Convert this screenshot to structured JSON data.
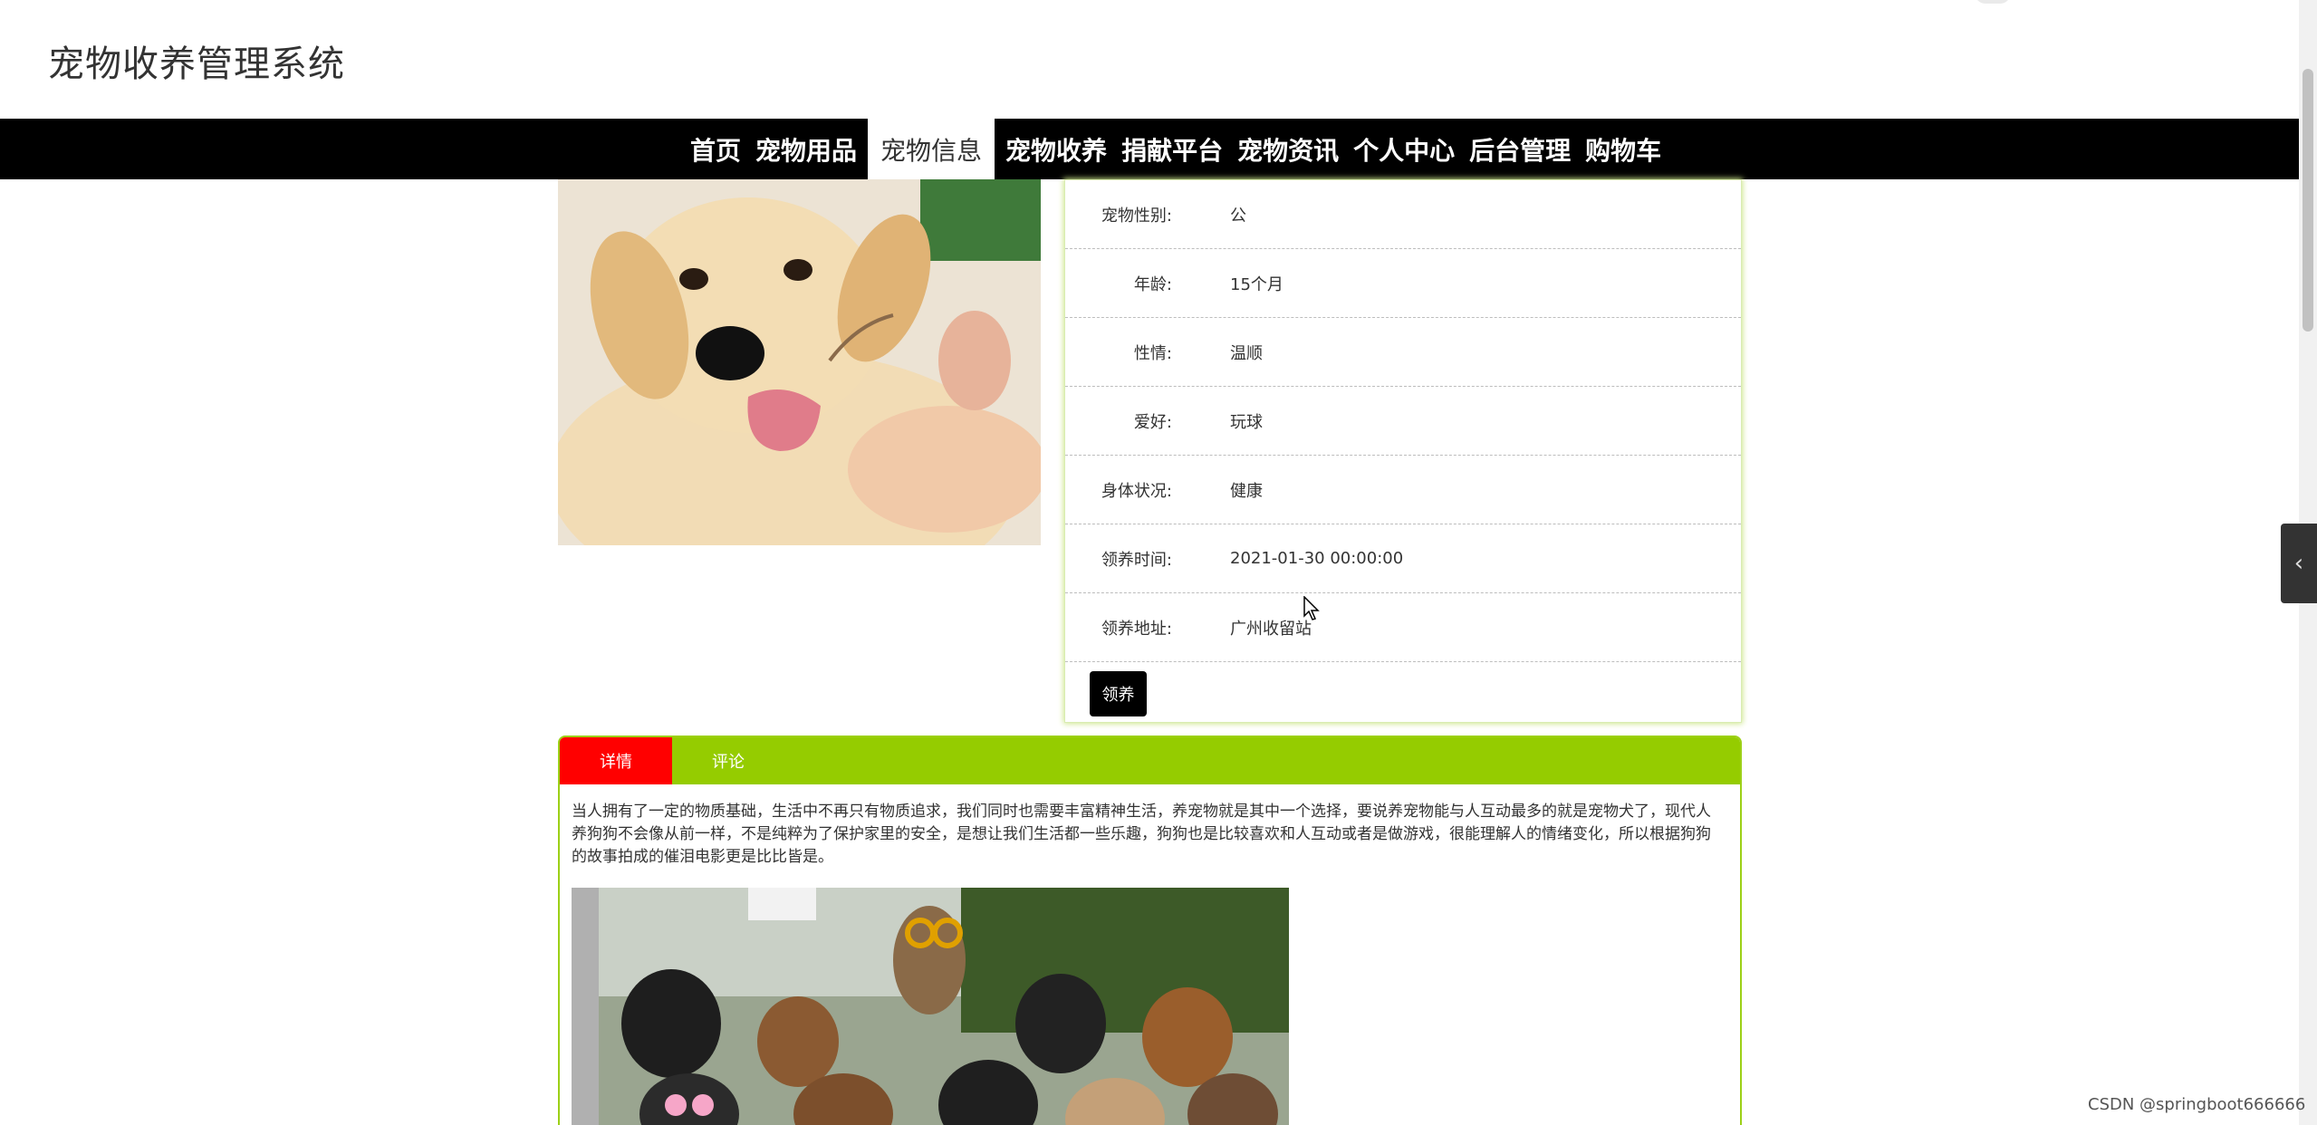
{
  "header": {
    "title": "宠物收养管理系统"
  },
  "nav": {
    "items": [
      {
        "label": "首页",
        "active": false
      },
      {
        "label": "宠物用品",
        "active": false
      },
      {
        "label": "宠物信息",
        "active": true
      },
      {
        "label": "宠物收养",
        "active": false
      },
      {
        "label": "捐献平台",
        "active": false
      },
      {
        "label": "宠物资讯",
        "active": false
      },
      {
        "label": "个人中心",
        "active": false
      },
      {
        "label": "后台管理",
        "active": false
      },
      {
        "label": "购物车",
        "active": false
      }
    ]
  },
  "pet": {
    "fields": [
      {
        "label": "宠物性别:",
        "value": "公"
      },
      {
        "label": "年龄:",
        "value": "15个月"
      },
      {
        "label": "性情:",
        "value": "温顺"
      },
      {
        "label": "爱好:",
        "value": "玩球"
      },
      {
        "label": "身体状况:",
        "value": "健康"
      },
      {
        "label": "领养时间:",
        "value": "2021-01-30 00:00:00"
      },
      {
        "label": "领养地址:",
        "value": "广州收留站"
      }
    ],
    "adopt_label": "领养"
  },
  "tabs": {
    "items": [
      {
        "label": "详情",
        "active": true
      },
      {
        "label": "评论",
        "active": false
      }
    ],
    "detail_text": "当人拥有了一定的物质基础，生活中不再只有物质追求，我们同时也需要丰富精神生活，养宠物就是其中一个选择，要说养宠物能与人互动最多的就是宠物犬了，现代人养狗狗不会像从前一样，不是纯粹为了保护家里的安全，是想让我们生活都一些乐趣，狗狗也是比较喜欢和人互动或者是做游戏，很能理解人的情绪变化，所以根据狗狗的故事拍成的催泪电影更是比比皆是。"
  },
  "watermark": "CSDN @springboot666666",
  "colors": {
    "nav_bg": "#000000",
    "tab_bar": "#95cc00",
    "tab_active": "#ff0000",
    "panel_glow": "#cde68a"
  },
  "icons": {
    "side_toggle": "chevron-left-icon"
  }
}
